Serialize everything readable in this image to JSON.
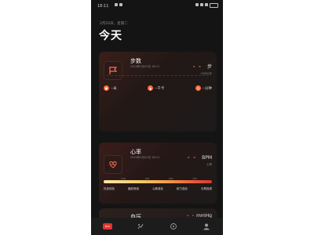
{
  "status": {
    "time": "18:11",
    "battery_icon": "battery-icon",
    "signal_icon": "signal-icon",
    "wifi_icon": "wifi-icon"
  },
  "header": {
    "date": "2月20日，星期二",
    "title": "今天"
  },
  "steps_card": {
    "title": "步数",
    "time": "2024年2月20日 18:11",
    "value": "- -",
    "unit": "步",
    "goal": "10000步",
    "icon": "flag-icon",
    "stats": [
      {
        "icon": "distance-icon",
        "label": "--米"
      },
      {
        "icon": "calorie-icon",
        "label": "--千卡"
      },
      {
        "icon": "clock-icon",
        "label": "--分钟"
      }
    ]
  },
  "heart_card": {
    "title": "心率",
    "time": "2024年2月20日 18:11",
    "value": "- -",
    "unit": "BPM",
    "sub_label": "心率",
    "icon": "heart-rate-icon",
    "ticks": [
      "114",
      "133",
      "152",
      "171"
    ],
    "zones": [
      "热身放松",
      "脂肪燃烧",
      "心肺强化",
      "耐力强化",
      "无氧极限"
    ]
  },
  "bp_card": {
    "title": "血压",
    "value": "- -",
    "unit": "mmHg"
  },
  "tabs": [
    {
      "name": "home-tab",
      "label": "BAS",
      "active": true
    },
    {
      "name": "sport-tab",
      "label": "",
      "active": false
    },
    {
      "name": "discover-tab",
      "label": "",
      "active": false
    },
    {
      "name": "profile-tab",
      "label": "",
      "active": false
    }
  ],
  "colors": {
    "accent": "#ff6b57",
    "background": "#141414",
    "tab_active": "#e0352b"
  }
}
